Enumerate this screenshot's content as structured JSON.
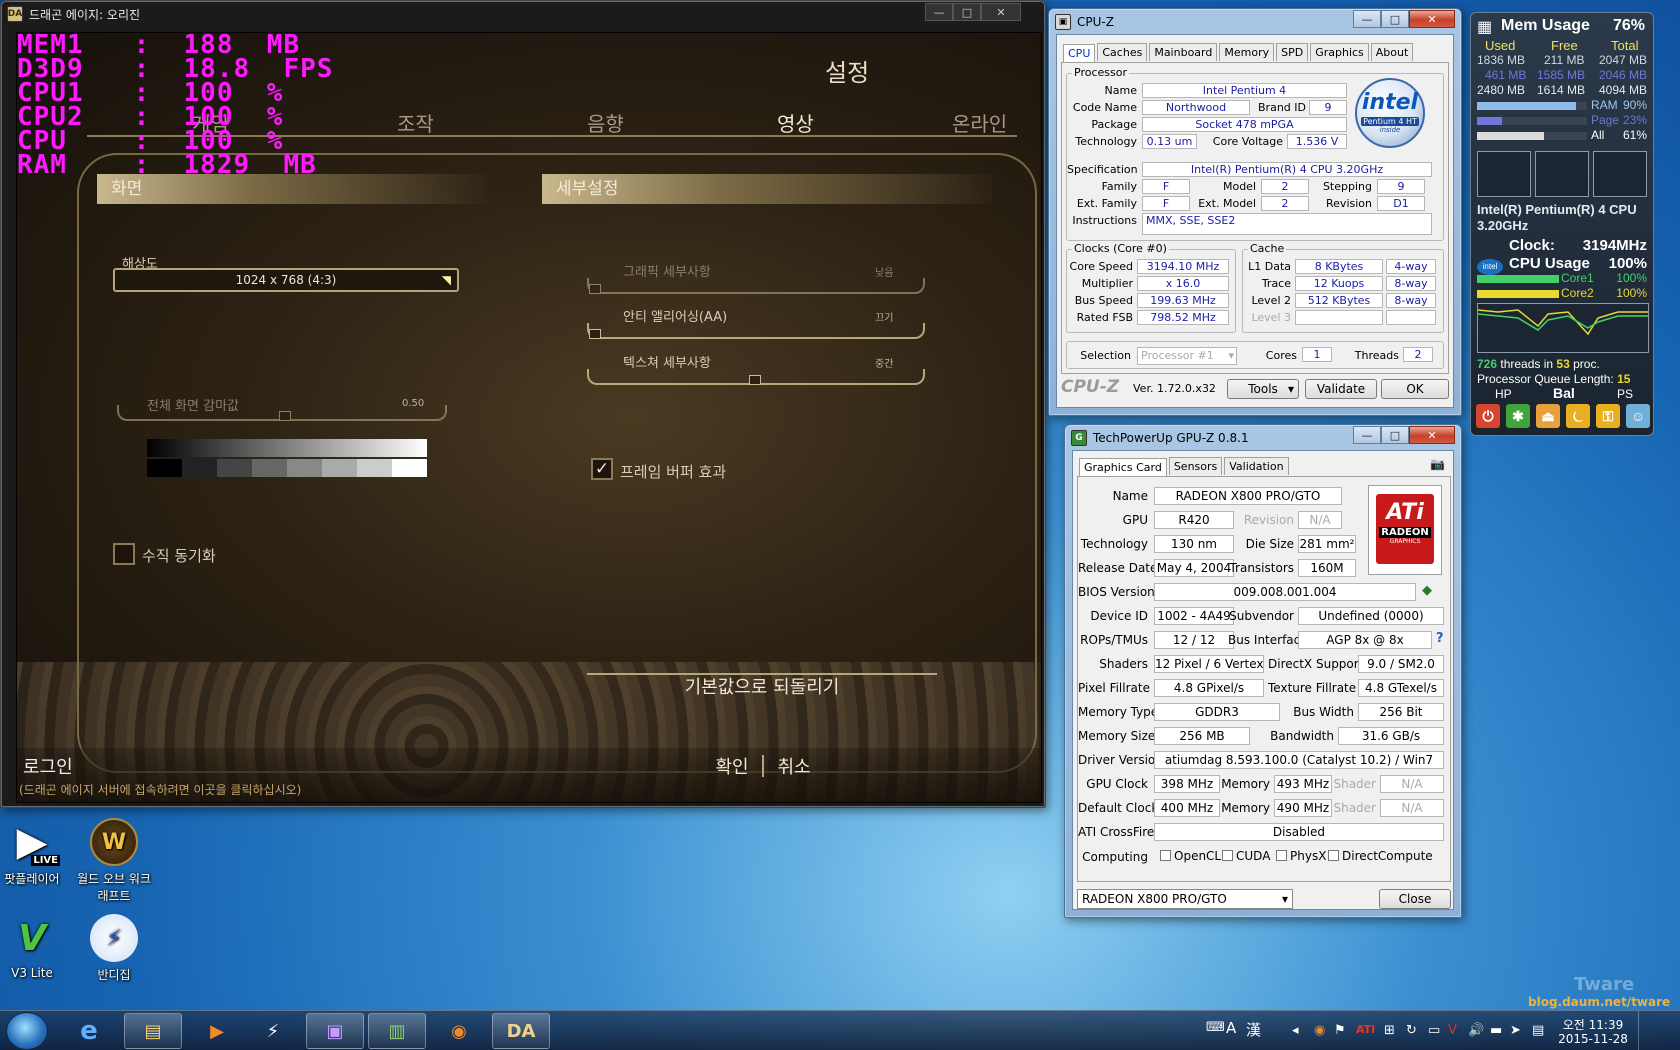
{
  "game": {
    "title": "드래곤 에이지: 오리진",
    "overlay": {
      "lines": [
        "MEM1   :  188  MB",
        "D3D9   :  18.8  FPS",
        "CPU1   :  100  %",
        "CPU2   :  100  %",
        "CPU    :  100  %",
        "RAM    :  1829  MB"
      ]
    },
    "settings_title": "설정",
    "tabs": [
      "게임",
      "조작",
      "음향",
      "영상",
      "온라인"
    ],
    "active_tab": "영상",
    "screen_section": "화면",
    "detail_section": "세부설정",
    "resolution_label": "해상도",
    "resolution_value": "1024 x 768 (4:3)",
    "gamma_label": "전체 화면 감마값",
    "gamma_value": "0.50",
    "vsync_label": "수직 동기화",
    "graphics_detail_label": "그래픽 세부사항",
    "graphics_detail_value": "낮음",
    "aa_label": "안티 앨리어싱(AA)",
    "aa_value": "끄기",
    "texture_label": "텍스쳐 세부사항",
    "texture_value": "중간",
    "framebuffer_label": "프레임 버퍼 효과",
    "reset_button": "기본값으로 되돌리기",
    "login": "로그인",
    "login_hint": "(드래곤 에이지 서버에 접속하려면 이곳을 클릭하십시오)",
    "ok_button": "확인",
    "cancel_button": "취소"
  },
  "cpuz": {
    "title": "CPU-Z",
    "tabs": [
      "CPU",
      "Caches",
      "Mainboard",
      "Memory",
      "SPD",
      "Graphics",
      "About"
    ],
    "processor_group": "Processor",
    "name_label": "Name",
    "name": "Intel Pentium 4",
    "codename_label": "Code Name",
    "codename": "Northwood",
    "brandid_label": "Brand ID",
    "brandid": "9",
    "package_label": "Package",
    "package": "Socket 478 mPGA",
    "technology_label": "Technology",
    "technology": "0.13 um",
    "voltage_label": "Core Voltage",
    "voltage": "1.536 V",
    "spec_label": "Specification",
    "spec": "Intel(R) Pentium(R) 4 CPU 3.20GHz",
    "family_label": "Family",
    "family": "F",
    "model_label": "Model",
    "model": "2",
    "stepping_label": "Stepping",
    "stepping": "9",
    "extfamily_label": "Ext. Family",
    "extfamily": "F",
    "extmodel_label": "Ext. Model",
    "extmodel": "2",
    "revision_label": "Revision",
    "revision": "D1",
    "instructions_label": "Instructions",
    "instructions": "MMX, SSE, SSE2",
    "logo_brand": "intel",
    "logo_sub": "Pentium 4 HT",
    "logo_inside": "inside",
    "clocks_group": "Clocks (Core #0)",
    "corespeed_label": "Core Speed",
    "corespeed": "3194.10 MHz",
    "multiplier_label": "Multiplier",
    "multiplier": "x 16.0",
    "busspeed_label": "Bus Speed",
    "busspeed": "199.63 MHz",
    "ratedfsb_label": "Rated FSB",
    "ratedfsb": "798.52 MHz",
    "cache_group": "Cache",
    "l1_label": "L1 Data",
    "l1": "8 KBytes",
    "l1_way": "4-way",
    "trace_label": "Trace",
    "trace": "12 Kuops",
    "trace_way": "8-way",
    "l2_label": "Level 2",
    "l2": "512 KBytes",
    "l2_way": "8-way",
    "l3_label": "Level 3",
    "selection_label": "Selection",
    "selection": "Processor #1",
    "cores_label": "Cores",
    "cores": "1",
    "threads_label": "Threads",
    "threads": "2",
    "brand": "CPU-Z",
    "version": "Ver. 1.72.0.x32",
    "tools_button": "Tools",
    "validate_button": "Validate",
    "ok_button": "OK"
  },
  "gpuz": {
    "title": "TechPowerUp GPU-Z 0.8.1",
    "tabs": [
      "Graphics Card",
      "Sensors",
      "Validation"
    ],
    "name_label": "Name",
    "name": "RADEON X800 PRO/GTO",
    "gpu_label": "GPU",
    "gpu": "R420",
    "revision_label": "Revision",
    "revision": "N/A",
    "technology_label": "Technology",
    "technology": "130 nm",
    "diesize_label": "Die Size",
    "diesize": "281 mm²",
    "release_label": "Release Date",
    "release": "May 4, 2004",
    "transistors_label": "Transistors",
    "transistors": "160M",
    "bios_label": "BIOS Version",
    "bios": "009.008.001.004",
    "deviceid_label": "Device ID",
    "deviceid": "1002 - 4A49",
    "subvendor_label": "Subvendor",
    "subvendor": "Undefined (0000)",
    "rops_label": "ROPs/TMUs",
    "rops": "12 / 12",
    "bus_label": "Bus Interface",
    "bus": "AGP 8x @ 8x",
    "help_mark": "?",
    "shaders_label": "Shaders",
    "shaders": "12 Pixel / 6 Vertex",
    "dx_label": "DirectX Support",
    "dx": "9.0 / SM2.0",
    "pixel_label": "Pixel Fillrate",
    "pixel": "4.8 GPixel/s",
    "texture_label": "Texture Fillrate",
    "texture": "4.8 GTexel/s",
    "memtype_label": "Memory Type",
    "memtype": "GDDR3",
    "buswidth_label": "Bus Width",
    "buswidth": "256 Bit",
    "memsize_label": "Memory Size",
    "memsize": "256 MB",
    "bandwidth_label": "Bandwidth",
    "bandwidth": "31.6 GB/s",
    "driver_label": "Driver Version",
    "driver": "atiumdag 8.593.100.0 (Catalyst 10.2) / Win7",
    "gpuclock_label": "GPU Clock",
    "gpuclock": "398 MHz",
    "memory_label": "Memory",
    "memclock": "493 MHz",
    "shader_label": "Shader",
    "shader": "N/A",
    "defclock_label": "Default Clock",
    "defclock": "400 MHz",
    "defmem": "490 MHz",
    "defshader": "N/A",
    "crossfire_label": "ATI CrossFire",
    "crossfire": "Disabled",
    "computing_label": "Computing",
    "compute": [
      "OpenCL",
      "CUDA",
      "PhysX",
      "DirectCompute"
    ],
    "ati_logo": "ATi",
    "ati_sub": "RADEON",
    "ati_sub2": "GRAPHICS",
    "selected_card": "RADEON X800 PRO/GTO",
    "close_button": "Close"
  },
  "gadget": {
    "mem_title": "Mem Usage",
    "mem_percent": "76%",
    "hdr_used": "Used",
    "hdr_free": "Free",
    "hdr_total": "Total",
    "row1": [
      "1836 MB",
      "211 MB",
      "2047 MB"
    ],
    "row2": [
      "461 MB",
      "1585 MB",
      "2046 MB"
    ],
    "row3": [
      "2480 MB",
      "1614 MB",
      "4094 MB"
    ],
    "ram_label": "RAM",
    "ram_pct": "90%",
    "page_label": "Page",
    "page_pct": "23%",
    "all_label": "All",
    "all_pct": "61%",
    "cpu_name": "Intel(R) Pentium(R) 4 CPU 3.20GHz",
    "clock_label": "Clock:",
    "clock": "3194MHz",
    "cpu_usage_label": "CPU Usage",
    "cpu_usage": "100%",
    "core1_label": "Core1",
    "core1": "100%",
    "core2_label": "Core2",
    "core2": "100%",
    "threads_count": "726",
    "threads_text": "threads in",
    "proc_count": "53",
    "proc_text": "proc.",
    "queue_text": "Processor Queue Length:",
    "queue": "15",
    "hp": "HP",
    "bal": "Bal",
    "ps": "PS"
  },
  "desktop": {
    "icons": [
      {
        "label": "팟플레이어",
        "badge": "LIVE"
      },
      {
        "label": "월드 오브 워크래프트"
      },
      {
        "label": "V3 Lite"
      },
      {
        "label": "반디집"
      }
    ],
    "watermark_title": "Tware",
    "watermark_url": "blog.daum.net/tware"
  },
  "taskbar": {
    "ime1": "A",
    "ime2": "漢",
    "time": "오전 11:39",
    "date": "2015-11-28"
  }
}
